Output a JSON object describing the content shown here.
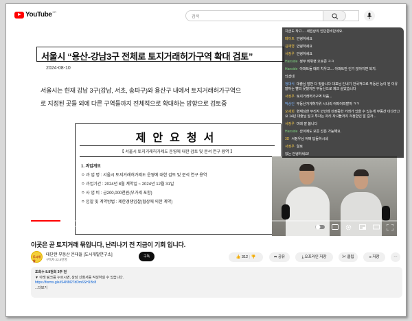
{
  "header": {
    "logo_text": "YouTube",
    "logo_country": "KR",
    "search_placeholder": "검색"
  },
  "player": {
    "document": {
      "title": "서울시 “용산-강남3구 전체로 토지거래허가구역 확대 검토”",
      "date": "2024-08-10",
      "body_line1": "서울시는 현재 강남 3구(강남, 서초, 송파구)와 용산구 내에서 토지거래허가구역으",
      "body_line2": "로 지정된 곳들 외에 다른 구역들까지 전체적으로 확대하는 방향으로 검토중",
      "proposal_title": "제안요청서",
      "proposal_sub": "【 서울시 토지거래허가제도 운영에 대한 검토 및 분석 연구 용역 】",
      "items": [
        "1. 과업개요",
        "ㅇ 과 업 명 : 서울시 토지거래허가제도 운영에 대한 검토 및 분석 연구 용역",
        "ㅇ 과업기간 : 2024년 8월 계약일 ~ 2024년 12월 31일",
        "ㅇ 사 업 비 : 금200,000천원(부가세 포함)",
        "ㅇ 입찰 및 계약방법 : 제한경쟁입찰(협상에 의한 계약)"
      ]
    },
    "chat": [
      {
        "who": "",
        "text": "지금도 작고.... 세입상의 인단준비단네요.",
        "color": "y"
      },
      {
        "who": "페이트",
        "text": "안녕하세요",
        "color": "y"
      },
      {
        "who": "김재형",
        "text": "안녕하세요",
        "color": "y"
      },
      {
        "who": "서정우",
        "text": "안녕하세요",
        "color": "y"
      },
      {
        "who": "Hanside",
        "text": "정부 비위현 오로큰 ㅋㅋ",
        "color": "g"
      },
      {
        "who": "Hanside",
        "text": "아파트들 때려 치우고.... 아파트만 인기 많아지면 되지.",
        "color": "g"
      },
      {
        "who": "",
        "text": "되겠네",
        "color": "y"
      },
      {
        "who": "정대식",
        "text": "대출님 말만 다 맞습니다 대표님 인내기 전국적으로 부동산 능이 된 이유 많아는 빨리 못했지만 부동산으로 제크 살았습니다",
        "color": "b"
      },
      {
        "who": "서정우",
        "text": "토지거래허가구역 처음...",
        "color": "y"
      },
      {
        "who": "박상인",
        "text": "부동산가게허가위 시나리 어떠어떠할까 ㅋㅋ",
        "color": "b"
      },
      {
        "who": "오세희",
        "text": "현재님한 무리지 안인데 진정중한 거래가 있을 수 있는게 부동산 이다라고요 14년 대출님 말고 투자는 자리 자녀들까지 걱정합인 알 걸까...",
        "color": "y"
      },
      {
        "who": "서정우",
        "text": "미래 잘 봅니다",
        "color": "y"
      },
      {
        "who": "Hanside",
        "text": "산이에도 모든 선은 가능해요.",
        "color": "g"
      },
      {
        "who": "3D",
        "text": "서정우님 어쩌 답들하시네",
        "color": "y"
      },
      {
        "who": "서정우",
        "text": "알로",
        "color": "y"
      },
      {
        "who": "",
        "text": "있는 안녕하세요!",
        "color": "y"
      }
    ],
    "progress_fraction": 0.08,
    "time_current": "0:42",
    "time_total": "4:28"
  },
  "video": {
    "title": "이곳은 곧 토지거래 묶입니다, 난리나기 전 지금이 기회 입니다.",
    "channel_name": "대단한 부동산 온대들 [도시개발연구소]",
    "channel_avatar_text": "도시개발",
    "subscribers": "구독자 22.8만명",
    "subscribe_label": "구독",
    "likes": "312",
    "share_label": "공유",
    "offline_label": "오프라인 저장",
    "clip_label": "클립",
    "save_label": "저장",
    "description": {
      "meta": "조회수 8.8천회  3주 전",
      "line1": "▼ 아래 링크를 누르시면, 상담 신청서를 작성하실 수 있습니다.",
      "link": "https://forms.gle/iS4NM27dDm6SH1Bc8",
      "more": "...더보기"
    }
  }
}
